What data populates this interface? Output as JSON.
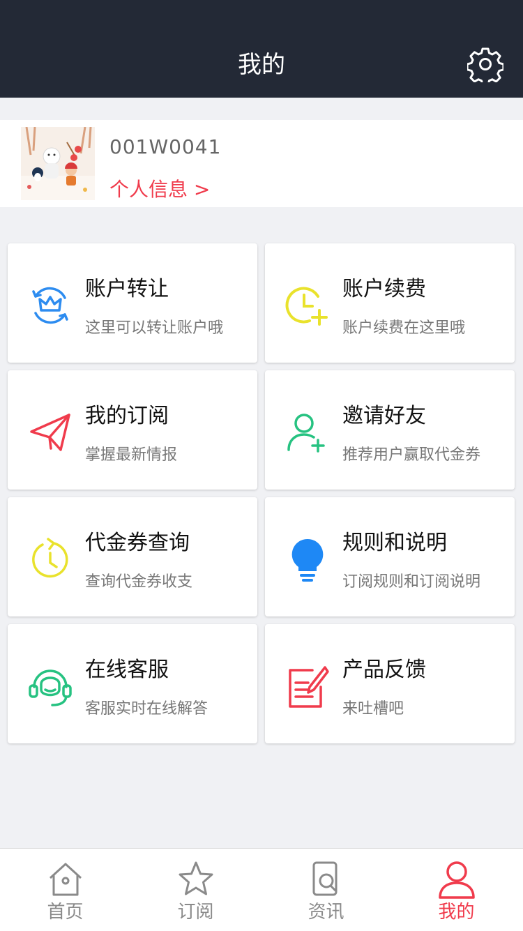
{
  "header": {
    "title": "我的",
    "settings_icon": "gear-icon"
  },
  "profile": {
    "user_id": "001W0041",
    "info_link": "个人信息 >"
  },
  "cards": [
    {
      "title": "账户转让",
      "subtitle": "这里可以转让账户哦",
      "icon": "crown-transfer-icon",
      "color": "#2d8cf0"
    },
    {
      "title": "账户续费",
      "subtitle": "账户续费在这里哦",
      "icon": "clock-plus-icon",
      "color": "#e9e22c"
    },
    {
      "title": "我的订阅",
      "subtitle": "掌握最新情报",
      "icon": "paper-plane-icon",
      "color": "#f03b4c"
    },
    {
      "title": "邀请好友",
      "subtitle": "推荐用户赢取代金券",
      "icon": "user-plus-icon",
      "color": "#26c281"
    },
    {
      "title": "代金券查询",
      "subtitle": "查询代金券收支",
      "icon": "history-icon",
      "color": "#e9e22c"
    },
    {
      "title": "规则和说明",
      "subtitle": "订阅规则和订阅说明",
      "icon": "lightbulb-icon",
      "color": "#1e88f5"
    },
    {
      "title": "在线客服",
      "subtitle": "客服实时在线解答",
      "icon": "headset-icon",
      "color": "#26c281"
    },
    {
      "title": "产品反馈",
      "subtitle": "来吐槽吧",
      "icon": "feedback-edit-icon",
      "color": "#f03b4c"
    }
  ],
  "tabs": [
    {
      "label": "首页",
      "icon": "home-icon"
    },
    {
      "label": "订阅",
      "icon": "star-icon"
    },
    {
      "label": "资讯",
      "icon": "news-search-icon"
    },
    {
      "label": "我的",
      "icon": "user-icon",
      "active": true
    }
  ],
  "colors": {
    "header_bg": "#232936",
    "accent": "#f03b4c",
    "page_bg": "#f0f1f4"
  }
}
